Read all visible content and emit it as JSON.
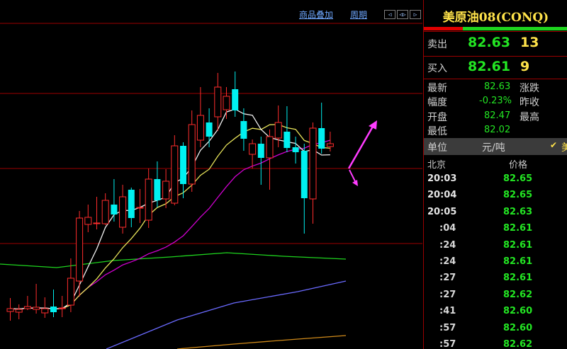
{
  "toolbar": {
    "overlay_link": "商品叠加",
    "period_link": "周期"
  },
  "panel": {
    "title": "美原油08(CONQ)",
    "sell_label": "卖出",
    "sell_price": "82.63",
    "sell_vol": "13",
    "buy_label": "买入",
    "buy_price": "82.61",
    "buy_vol": "9",
    "stats": [
      {
        "label": "最新",
        "value": "82.63",
        "label2": "涨跌",
        "color": "#23e523"
      },
      {
        "label": "幅度",
        "value": "-0.23%",
        "label2": "昨收",
        "color": "#23e523"
      },
      {
        "label": "开盘",
        "value": "82.47",
        "label2": "最高",
        "color": "#23e523"
      },
      {
        "label": "最低",
        "value": "82.02",
        "label2": "",
        "color": "#23e523"
      }
    ],
    "unit_label": "单位",
    "unit_value": "元/吨",
    "unit_extra": "美",
    "ticks_header_left": "北京",
    "ticks_header_right": "价格",
    "ticks": [
      {
        "time": "20:03",
        "price": "82.65",
        "short": false
      },
      {
        "time": "20:04",
        "price": "82.65",
        "short": false
      },
      {
        "time": "20:05",
        "price": "82.63",
        "short": false
      },
      {
        "time": ":04",
        "price": "82.61",
        "short": true
      },
      {
        "time": ":24",
        "price": "82.61",
        "short": true
      },
      {
        "time": ":24",
        "price": "82.61",
        "short": true
      },
      {
        "time": ":27",
        "price": "82.61",
        "short": true
      },
      {
        "time": ":27",
        "price": "82.62",
        "short": true
      },
      {
        "time": ":41",
        "price": "82.60",
        "short": true
      },
      {
        "time": ":57",
        "price": "82.60",
        "short": true
      },
      {
        "time": ":57",
        "price": "82.62",
        "short": true
      }
    ]
  },
  "chart_data": {
    "type": "candlestick",
    "colors": {
      "up": "#ff2d2d",
      "down": "#00f0f0",
      "ma5": "#f0f0f0",
      "ma10": "#e7e35a",
      "ma20": "#d000d0",
      "ma60": "#1ed41e",
      "ma120": "#6a6aff",
      "ma250": "#d08a1a"
    },
    "candles": [
      {
        "o": 0,
        "c": 0,
        "h": 0,
        "l": 0,
        "up": true
      },
      {
        "o": 53,
        "c": 57,
        "h": 72,
        "l": 40,
        "up": true
      },
      {
        "o": 52,
        "c": 56,
        "h": 63,
        "l": 42,
        "up": true
      },
      {
        "o": 57,
        "c": 60,
        "h": 75,
        "l": 55,
        "up": true
      },
      {
        "o": 56,
        "c": 59,
        "h": 92,
        "l": 50,
        "up": true
      },
      {
        "o": 51,
        "c": 57,
        "h": 73,
        "l": 44,
        "up": true
      },
      {
        "o": 60,
        "c": 52,
        "h": 84,
        "l": 45,
        "down": true
      },
      {
        "o": 58,
        "c": 58,
        "h": 75,
        "l": 45,
        "up": true
      },
      {
        "o": 62,
        "c": 100,
        "h": 128,
        "l": 52,
        "up": true
      },
      {
        "o": 96,
        "c": 185,
        "h": 195,
        "l": 74,
        "up": true
      },
      {
        "o": 176,
        "c": 186,
        "h": 204,
        "l": 165,
        "up": true
      },
      {
        "o": 178,
        "c": 178,
        "h": 215,
        "l": 169,
        "up": true
      },
      {
        "o": 177,
        "c": 210,
        "h": 220,
        "l": 175,
        "up": true
      },
      {
        "o": 204,
        "c": 190,
        "h": 240,
        "l": 180,
        "down": true
      },
      {
        "o": 172,
        "c": 215,
        "h": 232,
        "l": 163,
        "up": true
      },
      {
        "o": 225,
        "c": 185,
        "h": 228,
        "l": 172,
        "down": true
      },
      {
        "o": 200,
        "c": 200,
        "h": 226,
        "l": 178,
        "up": true
      },
      {
        "o": 182,
        "c": 240,
        "h": 255,
        "l": 171,
        "up": true
      },
      {
        "o": 240,
        "c": 210,
        "h": 265,
        "l": 200,
        "down": true
      },
      {
        "o": 212,
        "c": 237,
        "h": 254,
        "l": 199,
        "up": true
      },
      {
        "o": 206,
        "c": 287,
        "h": 302,
        "l": 203,
        "up": true
      },
      {
        "o": 287,
        "c": 233,
        "h": 292,
        "l": 213,
        "down": true
      },
      {
        "o": 233,
        "c": 317,
        "h": 337,
        "l": 222,
        "up": true
      },
      {
        "o": 295,
        "c": 330,
        "h": 370,
        "l": 285,
        "up": true
      },
      {
        "o": 320,
        "c": 300,
        "h": 340,
        "l": 285,
        "down": true
      },
      {
        "o": 328,
        "c": 370,
        "h": 390,
        "l": 308,
        "up": true
      },
      {
        "o": 338,
        "c": 357,
        "h": 370,
        "l": 325,
        "up": true
      },
      {
        "o": 367,
        "c": 337,
        "h": 392,
        "l": 328,
        "down": true
      },
      {
        "o": 322,
        "c": 297,
        "h": 340,
        "l": 280,
        "down": true
      },
      {
        "o": 275,
        "c": 290,
        "h": 296,
        "l": 255,
        "up": true
      },
      {
        "o": 290,
        "c": 270,
        "h": 300,
        "l": 232,
        "down": true
      },
      {
        "o": 270,
        "c": 300,
        "h": 310,
        "l": 225,
        "up": true
      },
      {
        "o": 298,
        "c": 320,
        "h": 344,
        "l": 285,
        "up": true
      },
      {
        "o": 307,
        "c": 284,
        "h": 343,
        "l": 278,
        "down": true
      },
      {
        "o": 285,
        "c": 278,
        "h": 300,
        "l": 262,
        "down": true
      },
      {
        "o": 280,
        "c": 213,
        "h": 290,
        "l": 163,
        "down": true
      },
      {
        "o": 212,
        "c": 312,
        "h": 320,
        "l": 177,
        "up": true
      },
      {
        "o": 312,
        "c": 283,
        "h": 348,
        "l": 276,
        "down": true
      },
      {
        "o": 290,
        "c": 286,
        "h": 307,
        "l": 279,
        "up": true
      }
    ]
  }
}
